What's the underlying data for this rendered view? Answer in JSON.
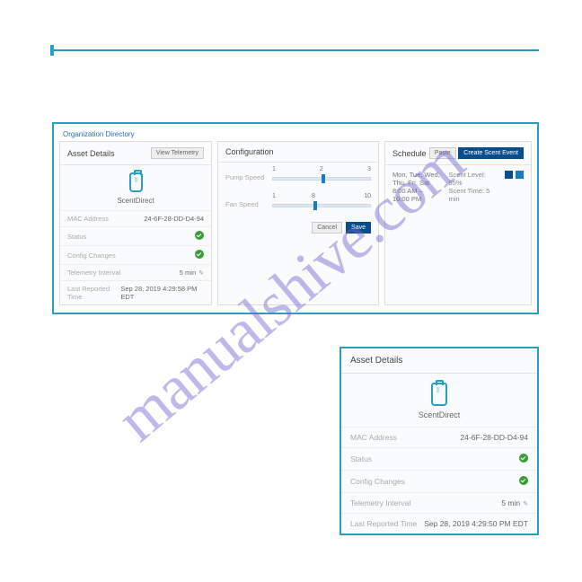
{
  "watermark": "manualshive.com",
  "breadcrumb": "Organization Directory",
  "asset": {
    "title": "Asset Details",
    "view_btn": "View Telemetry",
    "device_name": "ScentDirect",
    "rows": [
      {
        "label": "MAC Address",
        "value": "24-6F-28-DD-D4-94"
      },
      {
        "label": "Status",
        "value": "check"
      },
      {
        "label": "Config Changes",
        "value": "check"
      },
      {
        "label": "Telemetry Interval",
        "value": "5 min",
        "edit": true
      },
      {
        "label": "Last Reported Time",
        "value": "Sep 28, 2019 4:29:58 PM EDT"
      }
    ]
  },
  "config": {
    "title": "Configuration",
    "pump": {
      "label": "Pump Speed",
      "min": "1",
      "mid": "2",
      "max": "3",
      "pos": 50
    },
    "fan": {
      "label": "Fan Speed",
      "min": "1",
      "mid": "8",
      "max": "10",
      "pos": 42
    },
    "cancel": "Cancel",
    "save": "Save"
  },
  "schedule": {
    "title": "Schedule",
    "paste": "Paste",
    "create": "Create Scent Event",
    "days": "Mon, Tue, Wed, Thu, Fri, Sat",
    "time": "8:00 AM – 10:00 PM",
    "level": "Scent Level: 95%",
    "scent_time": "Scent Time: 5 min"
  },
  "zoom": {
    "title": "Asset Details",
    "device_name": "ScentDirect",
    "rows": [
      {
        "label": "MAC Address",
        "value": "24-6F-28-DD-D4-94"
      },
      {
        "label": "Status",
        "value": "check"
      },
      {
        "label": "Config Changes",
        "value": "check"
      },
      {
        "label": "Telemetry Interval",
        "value": "5 min",
        "edit": true
      },
      {
        "label": "Last Reported Time",
        "value": "Sep 28, 2019 4:29:50 PM EDT"
      }
    ]
  }
}
